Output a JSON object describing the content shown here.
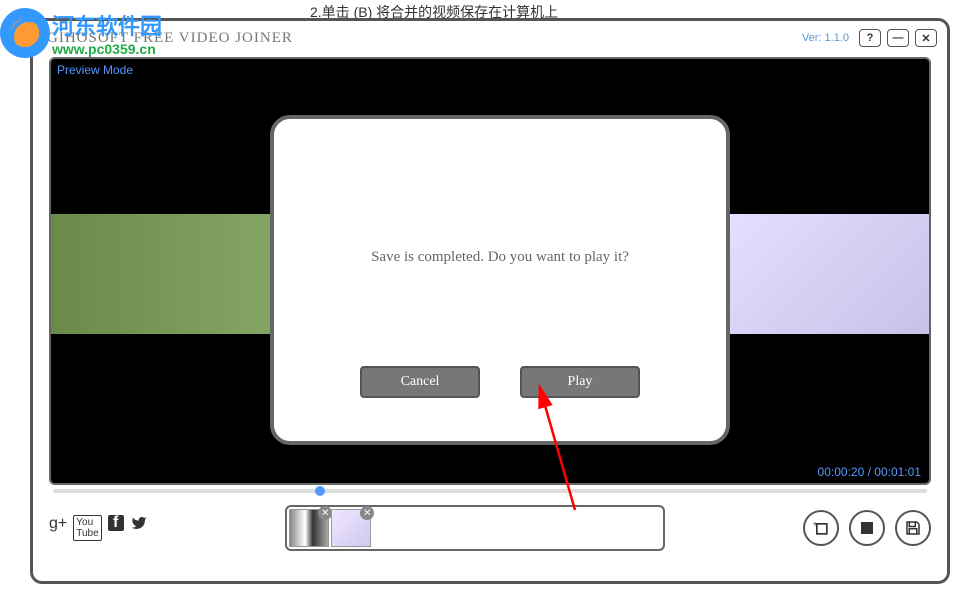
{
  "background_text": "2.单击  (B)  将合并的视频保存在计算机上",
  "watermark": {
    "cn": "河东软件园",
    "url": "www.pc0359.cn"
  },
  "app": {
    "title": "GIHOSOFT FREE VIDEO JOINER",
    "version": "Ver: 1.1.0"
  },
  "preview": {
    "mode_label": "Preview Mode",
    "current_time": "00:00:20",
    "total_time": "00:01:01"
  },
  "dialog": {
    "message": "Save is completed. Do you want to play it?",
    "cancel_label": "Cancel",
    "play_label": "Play"
  },
  "window_controls": {
    "help": "?",
    "minimize": "—",
    "close": "✕"
  },
  "icons": {
    "gplus": "g+",
    "youtube": "▶",
    "facebook": "f",
    "twitter": "🐦",
    "add": "+▢",
    "stop": "■",
    "save": "💾"
  }
}
